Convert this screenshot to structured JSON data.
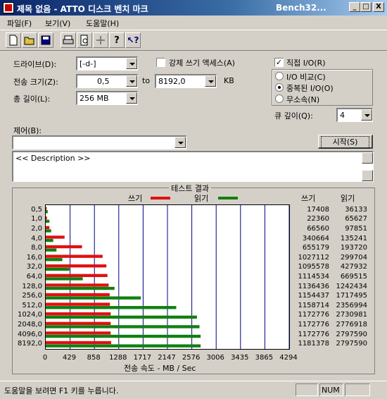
{
  "window": {
    "title": "제목 없음 - ATTO 디스크 벤치 마크",
    "title_right": "Bench32...",
    "btn_min": "_",
    "btn_max": "□",
    "btn_close": "X"
  },
  "menu": [
    "파일(F)",
    "보기(V)",
    "도움말(H)"
  ],
  "toolbar_icons": [
    "new-icon",
    "open-icon",
    "save-icon",
    "print-icon",
    "print-preview-icon",
    "move-icon",
    "help-icon",
    "context-help-icon"
  ],
  "form": {
    "drive_label": "드라이브(D):",
    "drive_value": "[-d-]",
    "force_write_label": "강제 쓰기 액세스(A)",
    "direct_io_label": "직접 I/O(R)",
    "direct_io_checked": "✓",
    "transfer_label": "전송 크기(Z):",
    "transfer_from": "0,5",
    "to_label": "to",
    "transfer_to": "8192,0",
    "kb_label": "KB",
    "total_label": "총 길이(L):",
    "total_value": "256 MB",
    "io_compare": "I/O 비교(C)",
    "overlapped_io": "중복된 I/O(O)",
    "neither": "무소속(N)",
    "queue_label": "큐 깊이(Q):",
    "queue_value": "4",
    "control_label": "제어(B):",
    "control_value": "",
    "start_button": "시작(S)",
    "description": "<< Description >>"
  },
  "results": {
    "title": "테스트 결과",
    "legend_write": "쓰기",
    "legend_read": "읽기",
    "write_color": "#e01010",
    "read_color": "#108010",
    "col_write": "쓰기",
    "col_read": "읽기",
    "xlabel": "전송 속도 - MB / Sec"
  },
  "chart_data": {
    "type": "bar",
    "orientation": "horizontal",
    "categories": [
      "0,5",
      "1,0",
      "2,0",
      "4,0",
      "8,0",
      "16,0",
      "32,0",
      "64,0",
      "128,0",
      "256,0",
      "512,0",
      "1024,0",
      "2048,0",
      "4096,0",
      "8192,0"
    ],
    "series": [
      {
        "name": "쓰기",
        "values": [
          17408,
          22360,
          66560,
          340664,
          655179,
          1027112,
          1095578,
          1114534,
          1136436,
          1154437,
          1158714,
          1172776,
          1172776,
          1172776,
          1181378
        ]
      },
      {
        "name": "읽기",
        "values": [
          36133,
          65627,
          97851,
          135241,
          193720,
          299704,
          427932,
          669515,
          1242434,
          1717495,
          2356994,
          2730981,
          2776918,
          2797590,
          2797590
        ]
      }
    ],
    "xticks": [
      "0",
      "429",
      "858",
      "1288",
      "1717",
      "2147",
      "2576",
      "3006",
      "3435",
      "3865",
      "4294"
    ],
    "xlim": [
      0,
      4294
    ],
    "xlabel": "전송 속도 - MB / Sec"
  },
  "status": {
    "help_text": "도움말을 보려면 F1 키를 누릅니다.",
    "num": "NUM"
  }
}
